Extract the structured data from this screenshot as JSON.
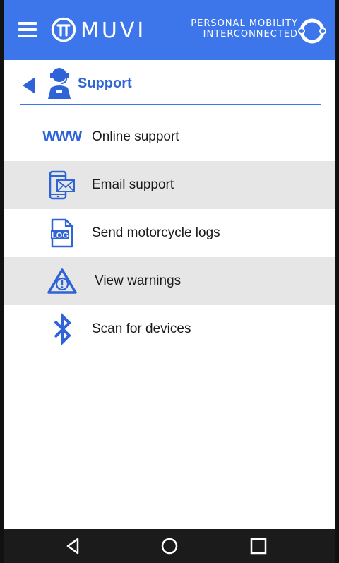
{
  "app": {
    "logo_text": "MUVI",
    "tagline_line1": "PERSONAL MOBILITY",
    "tagline_line2": "INTERCONNECTED",
    "brand_color": "#3c76ea"
  },
  "page": {
    "title": "Support"
  },
  "menu": {
    "items": [
      {
        "label": "Online support",
        "icon": "www-icon",
        "icon_text": "WWW",
        "highlighted": false
      },
      {
        "label": "Email support",
        "icon": "email-phone-icon",
        "highlighted": true
      },
      {
        "label": "Send motorcycle logs",
        "icon": "log-file-icon",
        "icon_text": "LOG",
        "highlighted": false
      },
      {
        "label": "View warnings",
        "icon": "warning-triangle-icon",
        "highlighted": true
      },
      {
        "label": "Scan for devices",
        "icon": "bluetooth-icon",
        "highlighted": false
      }
    ]
  },
  "navbar": {
    "buttons": [
      "back-nav-icon",
      "home-nav-icon",
      "recents-nav-icon"
    ]
  }
}
